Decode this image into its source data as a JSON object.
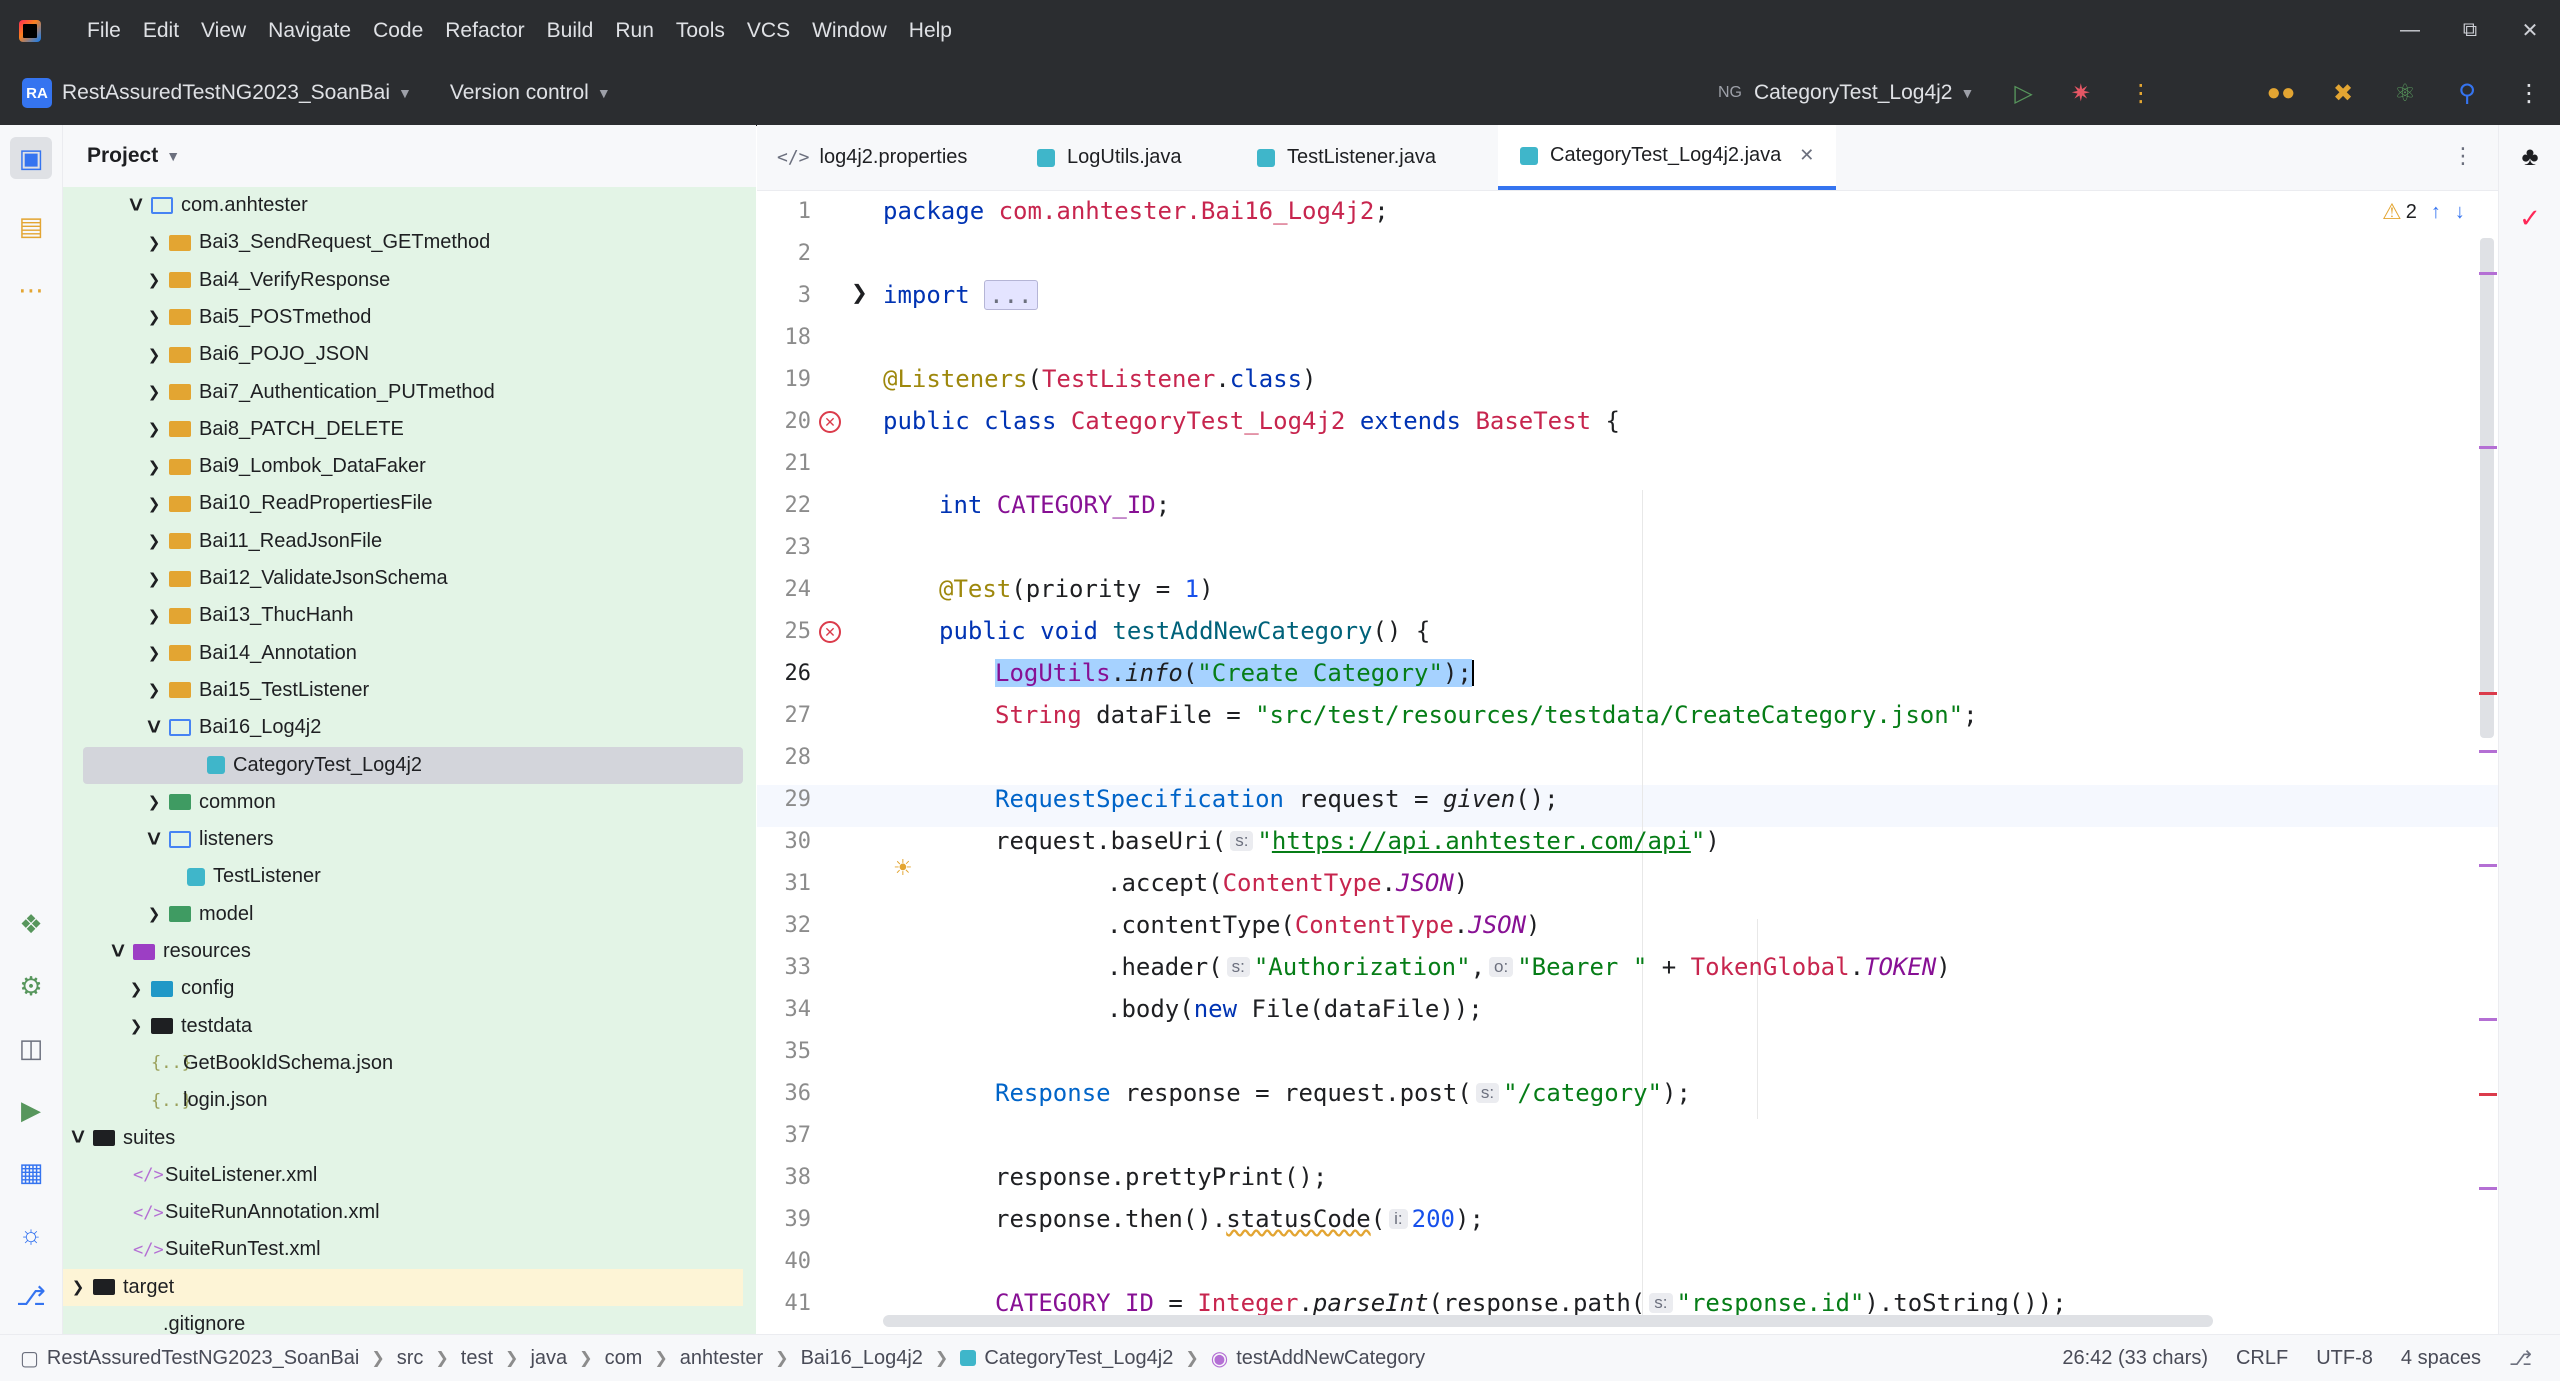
{
  "menu": [
    "File",
    "Edit",
    "View",
    "Navigate",
    "Code",
    "Refactor",
    "Build",
    "Run",
    "Tools",
    "VCS",
    "Window",
    "Help"
  ],
  "toolbar": {
    "project_badge": "RA",
    "project_name": "RestAssuredTestNG2023_SoanBai",
    "version_control": "Version control",
    "run_config": "CategoryTest_Log4j2"
  },
  "project_panel": {
    "title": "Project",
    "tree": [
      {
        "label": "com.anhtester",
        "level": 4,
        "arrow": "down",
        "icon": "folder-open"
      },
      {
        "label": "Bai3_SendRequest_GETmethod",
        "level": 5,
        "arrow": "right",
        "icon": "folder"
      },
      {
        "label": "Bai4_VerifyResponse",
        "level": 5,
        "arrow": "right",
        "icon": "folder"
      },
      {
        "label": "Bai5_POSTmethod",
        "level": 5,
        "arrow": "right",
        "icon": "folder"
      },
      {
        "label": "Bai6_POJO_JSON",
        "level": 5,
        "arrow": "right",
        "icon": "folder"
      },
      {
        "label": "Bai7_Authentication_PUTmethod",
        "level": 5,
        "arrow": "right",
        "icon": "folder"
      },
      {
        "label": "Bai8_PATCH_DELETE",
        "level": 5,
        "arrow": "right",
        "icon": "folder"
      },
      {
        "label": "Bai9_Lombok_DataFaker",
        "level": 5,
        "arrow": "right",
        "icon": "folder"
      },
      {
        "label": "Bai10_ReadPropertiesFile",
        "level": 5,
        "arrow": "right",
        "icon": "folder"
      },
      {
        "label": "Bai11_ReadJsonFile",
        "level": 5,
        "arrow": "right",
        "icon": "folder"
      },
      {
        "label": "Bai12_ValidateJsonSchema",
        "level": 5,
        "arrow": "right",
        "icon": "folder"
      },
      {
        "label": "Bai13_ThucHanh",
        "level": 5,
        "arrow": "right",
        "icon": "folder"
      },
      {
        "label": "Bai14_Annotation",
        "level": 5,
        "arrow": "right",
        "icon": "folder"
      },
      {
        "label": "Bai15_TestListener",
        "level": 5,
        "arrow": "right",
        "icon": "folder"
      },
      {
        "label": "Bai16_Log4j2",
        "level": 5,
        "arrow": "down",
        "icon": "folder-open"
      },
      {
        "label": "CategoryTest_Log4j2",
        "level": 6,
        "arrow": "none",
        "icon": "class",
        "selected": true
      },
      {
        "label": "common",
        "level": 5,
        "arrow": "right",
        "icon": "folder-green"
      },
      {
        "label": "listeners",
        "level": 5,
        "arrow": "down",
        "icon": "folder-open"
      },
      {
        "label": "TestListener",
        "level": 6,
        "arrow": "none",
        "icon": "class"
      },
      {
        "label": "model",
        "level": 5,
        "arrow": "right",
        "icon": "folder-green"
      },
      {
        "label": "resources",
        "level": 3,
        "arrow": "down",
        "icon": "folder-purple"
      },
      {
        "label": "config",
        "level": 4,
        "arrow": "right",
        "icon": "folder-teal"
      },
      {
        "label": "testdata",
        "level": 4,
        "arrow": "right",
        "icon": "folder-black"
      },
      {
        "label": "GetBookIdSchema.json",
        "level": 4,
        "arrow": "none",
        "icon": "json"
      },
      {
        "label": "login.json",
        "level": 4,
        "arrow": "none",
        "icon": "json"
      },
      {
        "label": "suites",
        "level": 1,
        "arrow": "down",
        "icon": "folder-black"
      },
      {
        "label": "SuiteListener.xml",
        "level": 2,
        "arrow": "none",
        "icon": "xml"
      },
      {
        "label": "SuiteRunAnnotation.xml",
        "level": 2,
        "arrow": "none",
        "icon": "xml"
      },
      {
        "label": "SuiteRunTest.xml",
        "level": 2,
        "arrow": "none",
        "icon": "xml"
      },
      {
        "label": "target",
        "level": 1,
        "arrow": "right",
        "icon": "folder-black",
        "yellow": true
      },
      {
        "label": ".gitignore",
        "level": 2,
        "arrow": "none",
        "icon": "none"
      }
    ]
  },
  "tabs": [
    {
      "label": "log4j2.properties",
      "icon": "props"
    },
    {
      "label": "LogUtils.java",
      "icon": "java"
    },
    {
      "label": "TestListener.java",
      "icon": "java"
    },
    {
      "label": "CategoryTest_Log4j2.java",
      "icon": "java",
      "active": true
    }
  ],
  "editor": {
    "warning_count": "2",
    "line_numbers": [
      "1",
      "2",
      "3",
      "18",
      "19",
      "20",
      "21",
      "22",
      "23",
      "24",
      "25",
      "26",
      "27",
      "28",
      "29",
      "30",
      "31",
      "32",
      "33",
      "34",
      "35",
      "36",
      "37",
      "38",
      "39",
      "40",
      "41"
    ],
    "code": {
      "l1a": "package ",
      "l1b": "com.anhtester.Bai16_Log4j2",
      "l1c": ";",
      "l3a": "import ",
      "l3b": "...",
      "l19a": "@Listeners",
      "l19b": "(",
      "l19c": "TestListener",
      "l19d": ".",
      "l19e": "class",
      "l19f": ")",
      "l20a": "public class ",
      "l20b": "CategoryTest_Log4j2",
      "l20c": " extends ",
      "l20d": "BaseTest",
      "l20e": " {",
      "l22a": "int ",
      "l22b": "CATEGORY_ID",
      "l22c": ";",
      "l24a": "@Test",
      "l24b": "(priority = ",
      "l24c": "1",
      "l24d": ")",
      "l25a": "public void ",
      "l25b": "testAddNewCategory",
      "l25c": "() {",
      "l26a": "LogUtils",
      "l26b": ".",
      "l26c": "info",
      "l26d": "(",
      "l26e": "\"Create Category\"",
      "l26f": ");",
      "l27a": "String ",
      "l27b": "dataFile = ",
      "l27c": "\"src/test/resources/testdata/CreateCategory.json\"",
      "l27d": ";",
      "l29a": "RequestSpecification ",
      "l29b": "request = ",
      "l29c": "given",
      "l29d": "();",
      "l30a": "request.baseUri(",
      "l30h": "s:",
      "l30b": "\"",
      "l30c": "https://api.anhtester.com/api",
      "l30d": "\"",
      "l30e": ")",
      "l31a": ".accept(",
      "l31b": "ContentType",
      "l31c": ".",
      "l31d": "JSON",
      "l31e": ")",
      "l32a": ".contentType(",
      "l32b": "ContentType",
      "l32c": ".",
      "l32d": "JSON",
      "l32e": ")",
      "l33a": ".header(",
      "l33h1": "s:",
      "l33b": "\"Authorization\"",
      "l33c": ",",
      "l33h2": "o:",
      "l33d": "\"Bearer \"",
      "l33e": " + ",
      "l33f": "TokenGlobal",
      "l33g": ".",
      "l33i": "TOKEN",
      "l33j": ")",
      "l34a": ".body(",
      "l34b": "new ",
      "l34c": "File(dataFile));",
      "l36a": "Response ",
      "l36b": "response = request.post(",
      "l36h": "s:",
      "l36c": "\"/category\"",
      "l36d": ");",
      "l38a": "response.prettyPrint();",
      "l39a": "response.then().",
      "l39b": "statusCode",
      "l39c": "(",
      "l39h": "i:",
      "l39d": "200",
      "l39e": ");",
      "l41a": "CATEGORY_ID",
      "l41b": " = ",
      "l41c": "Integer",
      "l41d": ".",
      "l41e": "parseInt",
      "l41f": "(response.path(",
      "l41h": "s:",
      "l41g": "\"response.id\"",
      "l41i": ").toString());"
    }
  },
  "statusbar": {
    "breadcrumbs": [
      "RestAssuredTestNG2023_SoanBai",
      "src",
      "test",
      "java",
      "com",
      "anhtester",
      "Bai16_Log4j2",
      "CategoryTest_Log4j2",
      "testAddNewCategory"
    ],
    "position": "26:42 (33 chars)",
    "line_sep": "CRLF",
    "encoding": "UTF-8",
    "indent": "4 spaces"
  }
}
